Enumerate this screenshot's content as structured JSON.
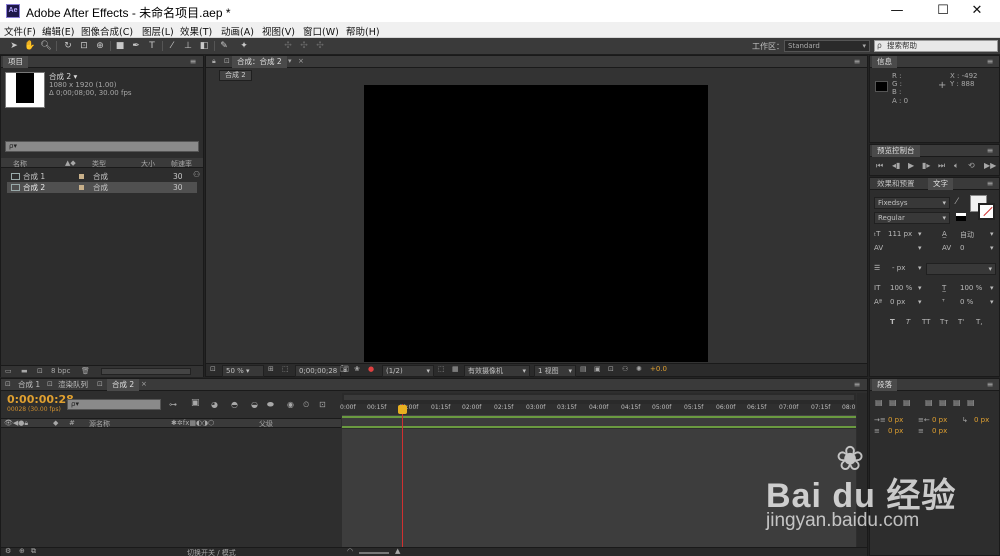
{
  "window": {
    "app_icon": "Ae",
    "title": "Adobe After Effects - 未命名项目.aep *",
    "controls": [
      "minimize-icon",
      "maximize-icon",
      "close-icon"
    ]
  },
  "menu": [
    "文件(F)",
    "编辑(E)",
    "图像合成(C)",
    "图层(L)",
    "效果(T)",
    "动画(A)",
    "视图(V)",
    "窗口(W)",
    "帮助(H)"
  ],
  "toolbar": {
    "workspace_label": "工作区：",
    "workspace_value": "Standard",
    "search_help_placeholder": "搜索帮助"
  },
  "project": {
    "tab": "项目",
    "comp_name": "合成 2 ▾",
    "comp_dims": "1080 x 1920 (1.00)",
    "comp_duration": "Δ 0;00;08;00, 30.00 fps",
    "search_placeholder": "ρ▾",
    "columns": [
      "名称",
      "类型",
      "大小",
      "帧速率"
    ],
    "items": [
      {
        "name": "合成 1",
        "type": "合成",
        "fps": "30",
        "selected": false
      },
      {
        "name": "合成 2",
        "type": "合成",
        "fps": "30",
        "selected": true
      }
    ],
    "bpc": "8 bpc"
  },
  "composition": {
    "tab": "合成：合成 2",
    "sub_tab": "合成 2",
    "zoom": "50 %",
    "timecode": "0;00;00;28",
    "resolution": "(1/2)",
    "camera": "有效摄像机",
    "views": "1 视图",
    "exposure": "+0.0",
    "canvas_color": "#000000"
  },
  "info": {
    "tab": "信息",
    "r": "R :",
    "g": "G :",
    "b": "B :",
    "a": "A : 0",
    "x": "X : -492",
    "y": "Y : 888"
  },
  "preview": {
    "tab": "预览控制台"
  },
  "character": {
    "tab_effects": "效果和预置",
    "tab_text": "文字",
    "font": "Fixedsys",
    "style": "Regular",
    "size": "111 px",
    "leading": "自动",
    "kerning": "0",
    "stroke": "- px",
    "vscale": "100 %",
    "hscale": "100 %",
    "baseline": "0 px",
    "tsume": "0 %",
    "styles": [
      "T",
      "T",
      "TT",
      "Tт",
      "T'",
      "T,"
    ]
  },
  "paragraph": {
    "tab": "段落",
    "indent_left": "0 px",
    "indent_right": "0 px",
    "indent_first": "0 px",
    "space_before": "0 px",
    "space_after": "0 px"
  },
  "timeline": {
    "tabs": [
      "合成 1",
      "渲染队列",
      "合成 2"
    ],
    "active_tab": "合成 2",
    "timecode": "0:00:00:28",
    "frame_info": "00028 (30.00 fps)",
    "search_placeholder": "ρ▾",
    "layer_col_source": "源名称",
    "layer_col_parent": "父级",
    "ruler": [
      "0:00f",
      "00:15f",
      "01:00f",
      "01:15f",
      "02:00f",
      "02:15f",
      "03:00f",
      "03:15f",
      "04:00f",
      "04:15f",
      "05:00f",
      "05:15f",
      "06:00f",
      "06:15f",
      "07:00f",
      "07:15f",
      "08:0"
    ],
    "bottom_toggle": "切换开关 / 模式",
    "playhead_time_fraction": 0.117
  },
  "watermark": {
    "brand": "Bai du 经验",
    "url": "jingyan.baidu.com"
  }
}
